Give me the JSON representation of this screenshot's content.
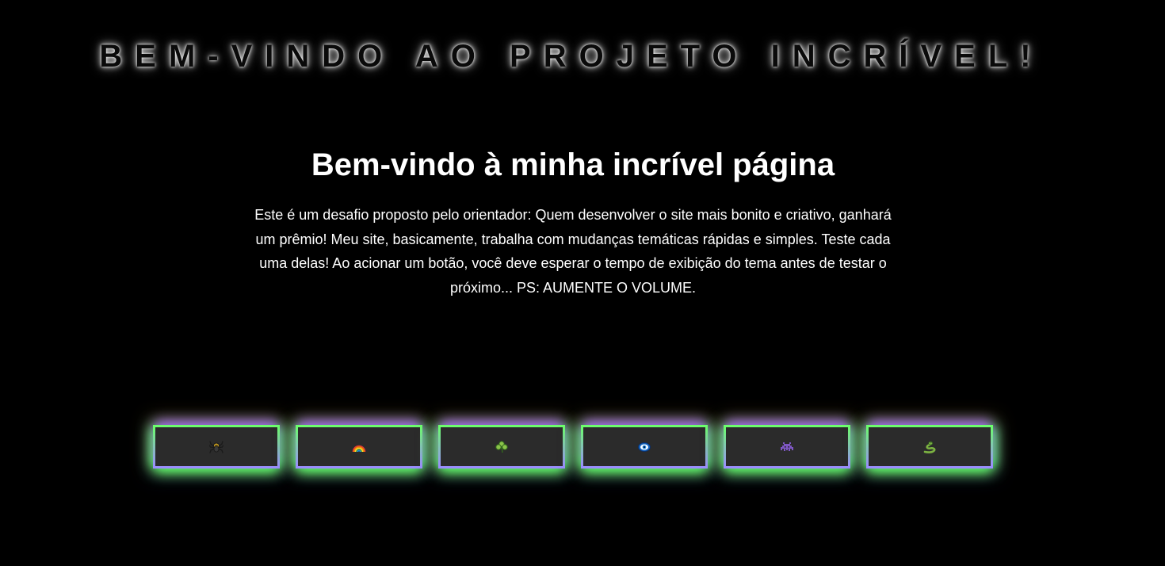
{
  "header": {
    "banner": "BEM-VINDO AO PROJETO INCRÍVEL!"
  },
  "main": {
    "title": "Bem-vindo à minha incrível página",
    "description": "Este é um desafio proposto pelo orientador: Quem desenvolver o site mais bonito e criativo, ganhará um prêmio! Meu site, basicamente, trabalha com mudanças temáticas rápidas e simples. Teste cada uma delas! Ao acionar um botão, você deve esperar o tempo de exibição do tema antes de testar o próximo... PS: AUMENTE O VOLUME."
  },
  "theme_buttons": [
    {
      "icon": "spider-icon"
    },
    {
      "icon": "rainbow-icon"
    },
    {
      "icon": "clover-icon"
    },
    {
      "icon": "eye-icon"
    },
    {
      "icon": "alien-monster-icon"
    },
    {
      "icon": "snake-icon"
    }
  ],
  "colors": {
    "background": "#000000",
    "text": "#ffffff",
    "button_fill": "#2b2b2b",
    "glow_green": "#6bff6b",
    "glow_purple": "#9b8cff"
  }
}
